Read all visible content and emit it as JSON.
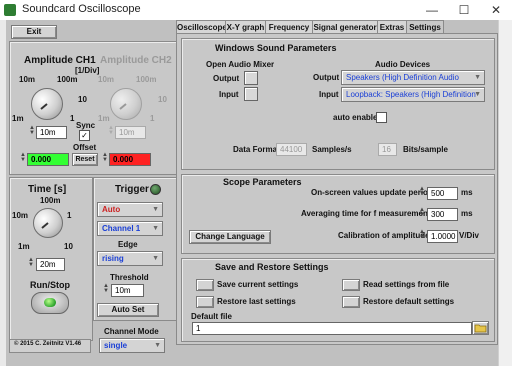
{
  "window": {
    "title": "Soundcard Oscilloscope",
    "minimize": "—",
    "maximize": "☐",
    "close": "✕"
  },
  "left": {
    "exit_label": "Exit",
    "ch1": {
      "title": "Amplitude CH1",
      "unit": "[1/Div]",
      "tick_10m": "10m",
      "tick_100m": "100m",
      "tick_1m": "1m",
      "tick_1": "1",
      "tick_10": "10",
      "value": "10m"
    },
    "ch2": {
      "title": "Amplitude CH2",
      "tick_10m": "10m",
      "tick_100m": "100m",
      "tick_1m": "1m",
      "tick_1": "1",
      "tick_10": "10",
      "value": "10m"
    },
    "sync_label": "Sync",
    "sync_checked": "✓",
    "offset_label": "Offset",
    "reset_label": "Reset",
    "offset_ch1": "0.000",
    "offset_ch2": "0.000",
    "time": {
      "title": "Time [s]",
      "tick_100m": "100m",
      "tick_10m": "10m",
      "tick_1": "1",
      "tick_1m": "1m",
      "tick_10": "10",
      "value": "20m"
    },
    "runstop_label": "Run/Stop",
    "trigger": {
      "title": "Trigger",
      "mode": "Auto",
      "channel": "Channel 1",
      "edge_label": "Edge",
      "edge": "rising",
      "threshold_label": "Threshold",
      "threshold": "10m",
      "autoset_label": "Auto Set"
    },
    "channel_mode_label": "Channel Mode",
    "channel_mode": "single",
    "copyright": "© 2015  C. Zeitnitz V1.46"
  },
  "tabs": [
    "Oscilloscope",
    "X-Y graph",
    "Frequency",
    "Signal generator",
    "Extras",
    "Settings"
  ],
  "settings": {
    "windows_sound": {
      "title": "Windows Sound Parameters",
      "mixer_title": "Open Audio Mixer",
      "devices_title": "Audio Devices",
      "output_label": "Output",
      "input_label": "Input",
      "dev_output_label": "Output",
      "dev_input_label": "Input",
      "output_device": "Speakers (High Definition Audio",
      "input_device": "Loopback: Speakers (High Definition",
      "auto_enable_label": "auto enable",
      "data_format_label": "Data Format",
      "sample_rate": "44100",
      "samples_unit": "Samples/s",
      "bits": "16",
      "bits_unit": "Bits/sample"
    },
    "scope": {
      "title": "Scope Parameters",
      "onscreen_label": "On-screen values update period",
      "onscreen_value": "500",
      "onscreen_unit": "ms",
      "averaging_label": "Averaging time for f measurement",
      "averaging_value": "300",
      "averaging_unit": "ms",
      "change_language_label": "Change Language",
      "calibration_label": "Calibration of amplitude",
      "calibration_value": "1.0000",
      "calibration_unit": "V/Div"
    },
    "save_restore": {
      "title": "Save and Restore Settings",
      "save_current": "Save current settings",
      "read_from_file": "Read settings from file",
      "restore_last": "Restore last settings",
      "restore_default": "Restore default settings",
      "default_file_label": "Default file",
      "default_file_value": "1"
    }
  },
  "colors": {
    "offset_ch1_bg": "#33ff33",
    "offset_ch2_bg": "#ff2222",
    "link_text": "#1a3fd6",
    "dropdown_red": "#cc2222"
  }
}
